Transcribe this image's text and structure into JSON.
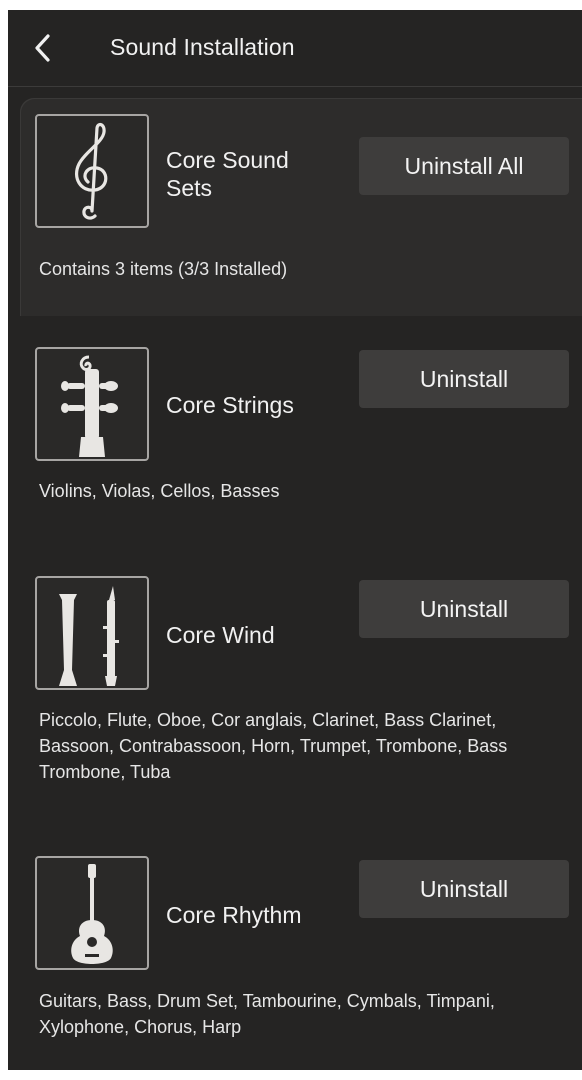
{
  "header": {
    "title": "Sound Installation",
    "back_icon": "chevron-left-icon"
  },
  "sound_sets": [
    {
      "name": "Core Sound Sets",
      "button_label": "Uninstall All",
      "description": "Contains 3 items (3/3 Installed)",
      "icon": "treble-clef-icon"
    },
    {
      "name": "Core Strings",
      "button_label": "Uninstall",
      "description": "Violins, Violas, Cellos, Basses",
      "icon": "violin-scroll-icon"
    },
    {
      "name": "Core Wind",
      "button_label": "Uninstall",
      "description": "Piccolo, Flute, Oboe, Cor anglais, Clarinet, Bass Clarinet, Bassoon, Contrabassoon, Horn, Trumpet, Trombone, Bass Trombone, Tuba",
      "icon": "woodwind-icon"
    },
    {
      "name": "Core Rhythm",
      "button_label": "Uninstall",
      "description": "Guitars, Bass, Drum Set, Tambourine, Cymbals, Timpani, Xylophone, Chorus, Harp",
      "icon": "guitar-icon"
    }
  ],
  "colors": {
    "background": "#252423",
    "card": "#2d2c2b",
    "button": "#3e3d3c",
    "text": "#f1f1f1",
    "border": "#a7a5a3"
  }
}
